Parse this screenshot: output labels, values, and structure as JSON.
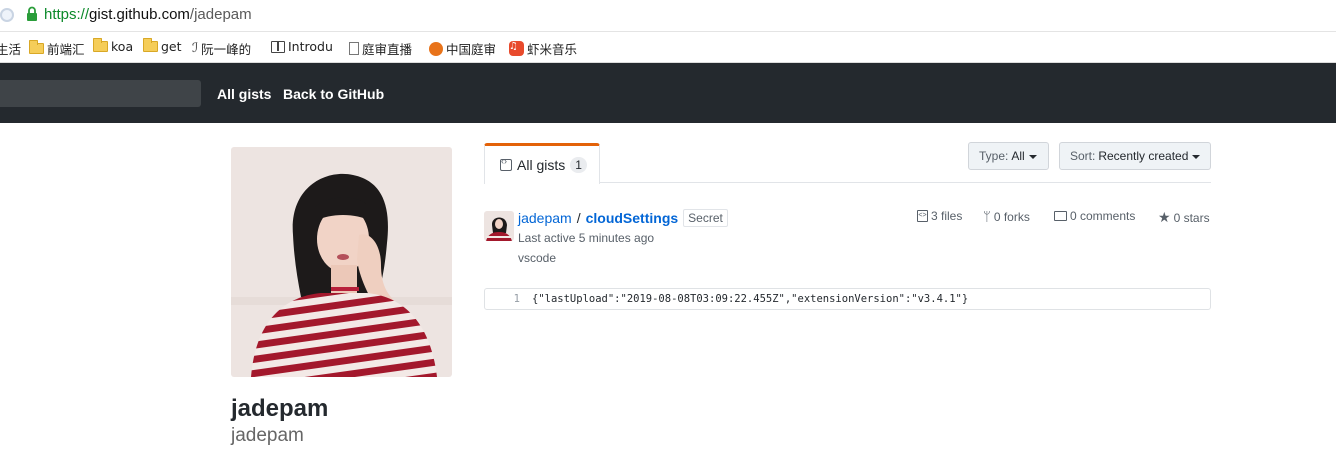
{
  "browser": {
    "url_scheme": "https://",
    "url_host": "gist.github.com",
    "url_path": "/jadepam",
    "bookmarks": [
      {
        "label": "生活",
        "icon": "folder-icon"
      },
      {
        "label": "前端汇",
        "icon": "folder-icon"
      },
      {
        "label": "koa",
        "icon": "folder-icon"
      },
      {
        "label": "get",
        "icon": "folder-icon"
      },
      {
        "label": "阮一峰的",
        "icon": "person-icon"
      },
      {
        "label": "Introdu",
        "icon": "book-icon"
      },
      {
        "label": "庭审直播",
        "icon": "document-icon"
      },
      {
        "label": "中国庭审",
        "icon": "court-logo-icon"
      },
      {
        "label": "虾米音乐",
        "icon": "xiami-icon"
      }
    ]
  },
  "header": {
    "all_gists": "All gists",
    "back_to_github": "Back to GitHub"
  },
  "profile": {
    "name": "jadepam",
    "login": "jadepam"
  },
  "tabs": {
    "all_gists_label": "All gists",
    "all_gists_count": "1"
  },
  "filters": {
    "type_label": "Type:",
    "type_value": "All",
    "sort_label": "Sort:",
    "sort_value": "Recently created"
  },
  "gist": {
    "owner": "jadepam",
    "separator": "/",
    "name": "cloudSettings",
    "visibility": "Secret",
    "last_active": "Last active 5 minutes ago",
    "description": "vscode",
    "files": "3 files",
    "forks": "0 forks",
    "comments": "0 comments",
    "stars": "0 stars",
    "preview_line_number": "1",
    "preview_code": "{\"lastUpload\":\"2019-08-08T03:09:22.455Z\",\"extensionVersion\":\"v3.4.1\"}"
  },
  "colors": {
    "header_bg": "#24292e",
    "link_blue": "#0366d6",
    "tab_accent": "#e36209"
  }
}
